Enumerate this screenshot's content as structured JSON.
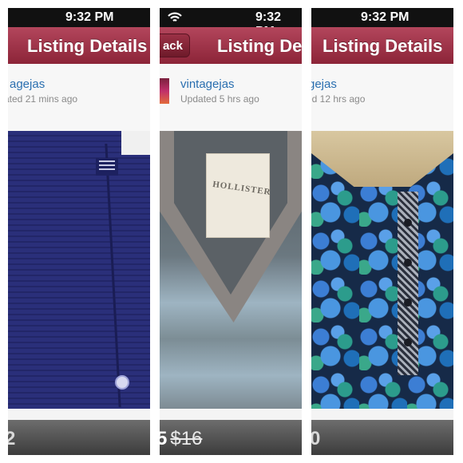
{
  "status_bar": {
    "time": "9:32 PM"
  },
  "panels": [
    {
      "nav_title": "Listing Details",
      "seller": "agejas",
      "updated": "ated 21 mins ago",
      "price_text": "2"
    },
    {
      "nav_title": "Listing De",
      "back_label": "ack",
      "seller": "vintagejas",
      "updated": "Updated 5 hrs ago",
      "price_text": "5",
      "original_price": "$16",
      "photo_label": "HOLLISTER"
    },
    {
      "nav_title": "Listing Details",
      "seller": "gejas",
      "updated": "ed 12 hrs ago",
      "price_text": "0"
    }
  ],
  "colors": {
    "navbar": "#9b3146",
    "link": "#2a6fb0"
  }
}
